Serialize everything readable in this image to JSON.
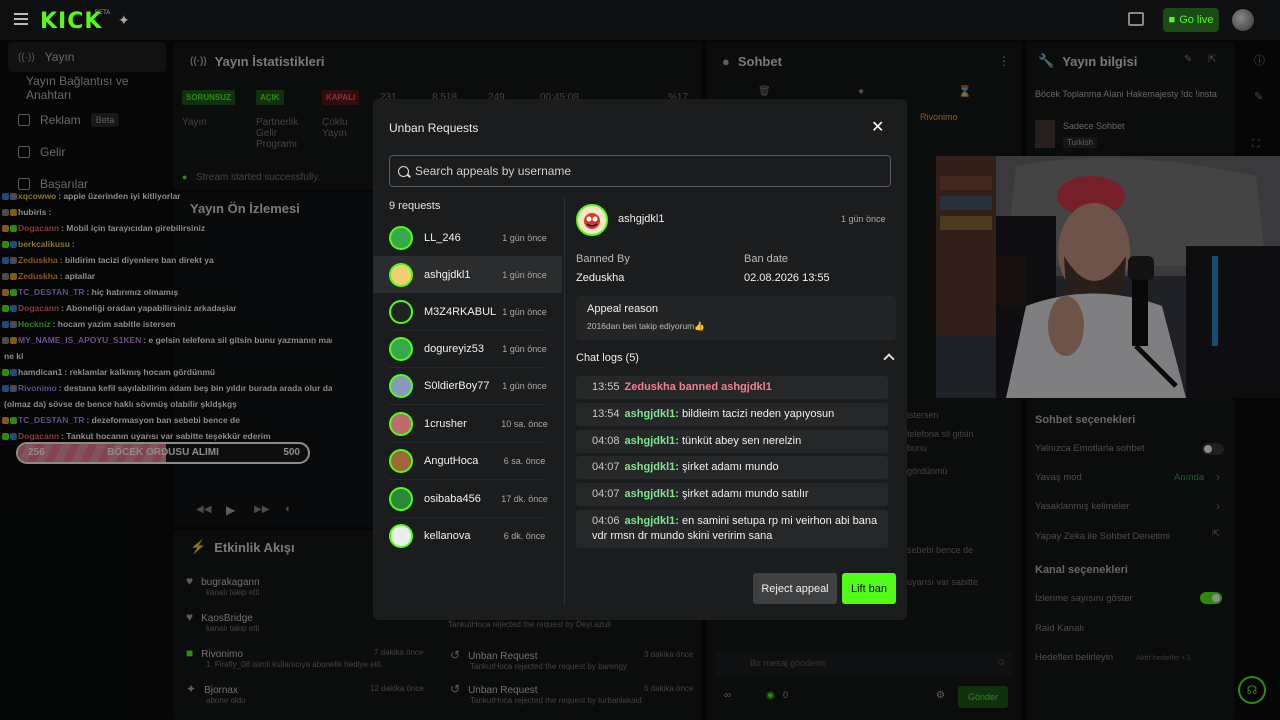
{
  "topbar": {
    "logo": "KICK",
    "logo_sup": "BETA",
    "go_live": "Go live"
  },
  "sidebar": {
    "items": [
      {
        "label": "Yayın"
      },
      {
        "label": "Yayın Bağlantısı ve Anahtarı"
      },
      {
        "label": "Reklam",
        "badge": "Beta"
      },
      {
        "label": "Gelir"
      },
      {
        "label": "Başarılar"
      }
    ]
  },
  "stats_panel": {
    "title": "Yayın İstatistikleri",
    "tags": [
      "SORUNSUZ",
      "AÇIK",
      "KAPALI"
    ],
    "numbers": [
      "231",
      "8.518",
      "249",
      "00:45:08",
      "%17"
    ],
    "labels": [
      "Yayın",
      "Partnerlik Gelir Programı",
      "Çoklu Yayın"
    ],
    "status": "Stream started successfully.",
    "preview_title": "Yayın Ön İzlemesi"
  },
  "activity_panel": {
    "title": "Etkinlik Akışı",
    "items": [
      {
        "name": "bugrakagann",
        "sub": "kanalı takip etti",
        "time": ""
      },
      {
        "name": "KaosBridge",
        "sub": "kanalı takip etti",
        "time": ""
      },
      {
        "name": "Rivonimo",
        "sub": "1. Firefly_08 isimli kullanıcıya abonelik hediye etti.",
        "time": "7 dakika önce"
      },
      {
        "name": "Bjornax",
        "sub": "abone oldu",
        "time": "12 dakika önce"
      }
    ],
    "unban_rows": [
      {
        "title": "Unban Request",
        "sub": "TankutHoca rejected the request by Deyi.azuli",
        "time": ""
      },
      {
        "title": "Unban Request",
        "sub": "TankutHoca rejected the request by barengy",
        "time": "3 dakika önce"
      },
      {
        "title": "Unban Request",
        "sub": "TankutHoca rejected the request by turbanlakald",
        "time": "6 dakika önce"
      }
    ]
  },
  "chat_panel": {
    "title": "Sohbet",
    "placeholder": "Bir mesaj gönderin",
    "send": "Gönder",
    "count": "0",
    "pinned_user": "Rivonimo",
    "side_fragments": [
      "istersen",
      "telefona sil gitsin",
      "bunu",
      "gördünmü",
      "sebebi bence de",
      "uyarısı var sabitte"
    ]
  },
  "info_panel": {
    "title": "Yayın bilgisi",
    "stream_title": "Böcek Toplanma Alanı Hakemajesty !dc !insta",
    "category": "Sadece Sohbet",
    "language": "Turkish",
    "chat_options_title": "Sohbet seçenekleri",
    "chat_options": [
      {
        "label": "Yalnızca Emotlarla sohbet",
        "value": ""
      },
      {
        "label": "Yavaş mod",
        "value": "Anında"
      },
      {
        "label": "Yasaklanmış kelimeler",
        "value": ""
      },
      {
        "label": "Yapay Zeka ile Sohbet Denetimi",
        "value": ""
      }
    ],
    "channel_options_title": "Kanal seçenekleri",
    "channel_options": [
      {
        "label": "İzlenme sayısını göster",
        "value": ""
      },
      {
        "label": "Raid Kanalı",
        "value": ""
      },
      {
        "label": "Hedefleri belirleyin",
        "value": "Aktif hedefler • 1"
      }
    ]
  },
  "chat_overlay": [
    {
      "user": "xqcowwo",
      "color": "#ffd84a",
      "msg": ": apple üzerinden iyi kitliyorlar"
    },
    {
      "user": "hubiris",
      "color": "#ffffff",
      "msg": ":"
    },
    {
      "user": "Dogacann",
      "color": "#ff6b6b",
      "msg": ": Mobil için tarayıcıdan girebilirsiniz"
    },
    {
      "user": "berkcalikusu",
      "color": "#ffd84a",
      "msg": ":"
    },
    {
      "user": "Zeduskha",
      "color": "#ffa53a",
      "msg": ": bildirim tacizi diyenlere ban direkt ya"
    },
    {
      "user": "Zeduskha",
      "color": "#ffa53a",
      "msg": ": aptallar"
    },
    {
      "user": "TC_DESTAN_TR",
      "color": "#b48aff",
      "msg": ": hiç hatırımız olmamış"
    },
    {
      "user": "Dogacann",
      "color": "#ff6b6b",
      "msg": ": Aboneliği oradan yapabilirsiniz arkadaşlar"
    },
    {
      "user": "Hockniz",
      "color": "#53fc18",
      "msg": ": hocam yazim sabitle istersen"
    },
    {
      "user": "MY_NAME_IS_APOYU_S1KEN",
      "color": "#d08aff",
      "msg": ": e gelsin telefona sil gitsin bunu yazmanın mantığı"
    },
    {
      "user": "",
      "color": "#ffffff",
      "msg": "ne ki"
    },
    {
      "user": "hamdican1",
      "color": "#ffffff",
      "msg": ": reklamlar kalkmış hocam gördünmü"
    },
    {
      "user": "Rivonimo",
      "color": "#b48aff",
      "msg": ": destana kefil sayılabilirim adam beş bin yıldır burada arada olur da"
    },
    {
      "user": "",
      "color": "#ffffff",
      "msg": "(olmaz da) sövse de bence haklı sövmüş olabilir şkldşkgş"
    },
    {
      "user": "TC_DESTAN_TR",
      "color": "#b48aff",
      "msg": ": dezeformasyon ban sebebi bence de"
    },
    {
      "user": "Dogacann",
      "color": "#ff6b6b",
      "msg": ": Tankut hocanın uyarısı var sabitte teşekkür ederim"
    }
  ],
  "goal": {
    "current": "256",
    "title": "BÖCEK ORDUSU ALIMI",
    "target": "500",
    "progress": 0.512
  },
  "modal": {
    "title": "Unban Requests",
    "search_placeholder": "Search appeals by username",
    "count_label": "9 requests",
    "requests": [
      {
        "name": "LL_246",
        "time": "1 gün önce",
        "color": "#3aa84a"
      },
      {
        "name": "ashgjdkl1",
        "time": "1 gün önce",
        "color": "#f0d070",
        "selected": true
      },
      {
        "name": "M3Z4RKABUL",
        "time": "1 gün önce",
        "color": "#222"
      },
      {
        "name": "dogureyiz53",
        "time": "1 gün önce",
        "color": "#3aa84a"
      },
      {
        "name": "S0ldierBoy77",
        "time": "1 gün önce",
        "color": "#8a9abf"
      },
      {
        "name": "1crusher",
        "time": "10 sa. önce",
        "color": "#c06a70"
      },
      {
        "name": "AngutHoca",
        "time": "6 sa. önce",
        "color": "#a0683a"
      },
      {
        "name": "osibaba456",
        "time": "17 dk. önce",
        "color": "#2a8a3a"
      },
      {
        "name": "kellanova",
        "time": "6 dk. önce",
        "color": "#eeeeee"
      }
    ],
    "detail": {
      "name": "ashgjdkl1",
      "time": "1 gün önce",
      "banned_by_label": "Banned By",
      "banned_by": "Zeduskha",
      "ban_date_label": "Ban date",
      "ban_date": "02.08.2026 13:55",
      "appeal_reason_label": "Appeal reason",
      "appeal_reason": "2016dan beri takip ediyorum👍",
      "chat_logs_label": "Chat logs (5)",
      "logs": [
        {
          "time": "13:55",
          "user": "",
          "msg": "Zeduskha banned ashgjdkl1",
          "system": true
        },
        {
          "time": "13:54",
          "user": "ashgjdkl1:",
          "msg": "bildieim tacizi neden yapıyosun"
        },
        {
          "time": "04:08",
          "user": "ashgjdkl1:",
          "msg": "tünküt abey sen nerelzin"
        },
        {
          "time": "04:07",
          "user": "ashgjdkl1:",
          "msg": "şirket adamı mundo"
        },
        {
          "time": "04:07",
          "user": "ashgjdkl1:",
          "msg": "şirket adamı mundo satılır"
        },
        {
          "time": "04:06",
          "user": "ashgjdkl1:",
          "msg": "en samini setupa rp mi veirhon abi bana vdr rmsn dr mundo skini veririm sana"
        }
      ]
    },
    "reject_label": "Reject appeal",
    "lift_label": "Lift ban"
  },
  "colors": {
    "accent": "#53fc18",
    "modal_bg": "#1b1c1d",
    "system_msg": "#f08090",
    "username": "#7fe38f"
  }
}
